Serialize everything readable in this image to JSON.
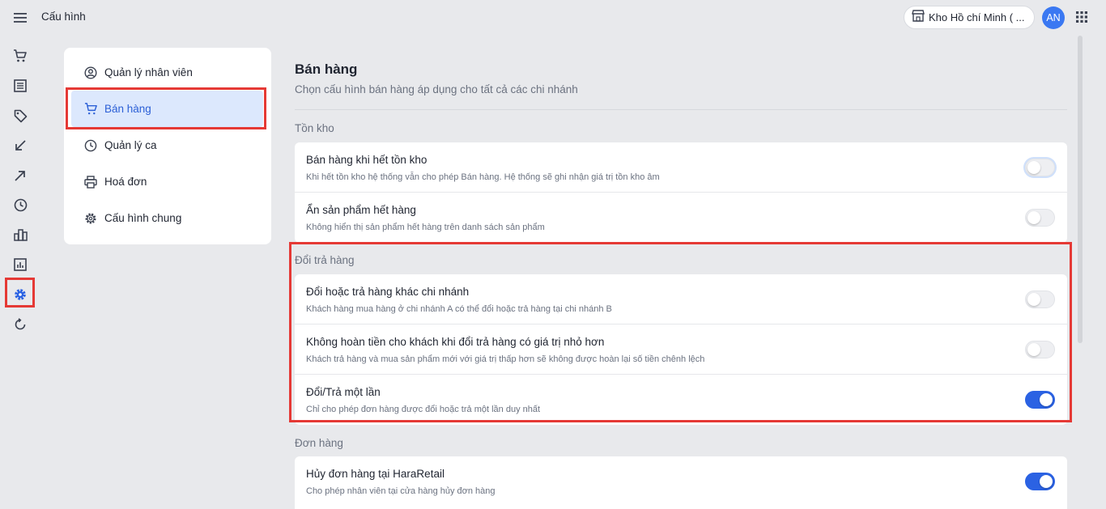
{
  "header": {
    "page_title": "Cấu hình",
    "store_name": "Kho Hồ chí Minh ( ...",
    "avatar_initials": "AN"
  },
  "rail": {
    "items": [
      {
        "icon": "cart-icon"
      },
      {
        "icon": "list-icon"
      },
      {
        "icon": "tag-icon"
      },
      {
        "icon": "arrow-down-left-icon"
      },
      {
        "icon": "arrow-up-right-icon"
      },
      {
        "icon": "clock-icon"
      },
      {
        "icon": "buildings-icon"
      },
      {
        "icon": "report-icon"
      },
      {
        "icon": "gear-icon",
        "active": true
      },
      {
        "icon": "refresh-icon"
      }
    ]
  },
  "settings_nav": {
    "items": [
      {
        "label": "Quản lý nhân viên",
        "icon": "user-circle-icon"
      },
      {
        "label": "Bán hàng",
        "icon": "cart-icon",
        "active": true
      },
      {
        "label": "Quản lý ca",
        "icon": "clock-icon"
      },
      {
        "label": "Hoá đơn",
        "icon": "printer-icon"
      },
      {
        "label": "Cấu hình chung",
        "icon": "gear-icon"
      }
    ]
  },
  "content": {
    "title": "Bán hàng",
    "subtitle": "Chọn cấu hình bán hàng áp dụng cho tất cả các chi nhánh",
    "sections": [
      {
        "title": "Tồn kho",
        "rows": [
          {
            "title": "Bán hàng khi hết tồn kho",
            "desc": "Khi hết tồn kho hệ thống vẫn cho phép Bán hàng. Hệ thống sẽ ghi nhận giá trị tồn kho âm",
            "enabled": false
          },
          {
            "title": "Ẩn sản phẩm hết hàng",
            "desc": "Không hiển thị sản phẩm hết hàng trên danh sách sản phẩm",
            "enabled": false
          }
        ]
      },
      {
        "title": "Đổi trả hàng",
        "rows": [
          {
            "title": "Đổi hoặc trả hàng khác chi nhánh",
            "desc": "Khách hàng mua hàng ở chi nhánh A có thể đổi hoặc trả hàng tại chi nhánh B",
            "enabled": false
          },
          {
            "title": "Không hoàn tiền cho khách khi đổi trả hàng có giá trị nhỏ hơn",
            "desc": "Khách trả hàng và mua sản phẩm mới với giá trị thấp hơn sẽ không được hoàn lại số tiền chênh lệch",
            "enabled": false
          },
          {
            "title": "Đổi/Trả một lần",
            "desc": "Chỉ cho phép đơn hàng được đổi hoặc trả một lần duy nhất",
            "enabled": true
          }
        ]
      },
      {
        "title": "Đơn hàng",
        "rows": [
          {
            "title": "Hủy đơn hàng tại HaraRetail",
            "desc": "Cho phép nhân viên tại cửa hàng hủy đơn hàng",
            "enabled": true
          }
        ]
      }
    ]
  },
  "colors": {
    "accent": "#2b62e3",
    "highlight": "#e53935",
    "active_nav_bg": "#dce8fd"
  }
}
